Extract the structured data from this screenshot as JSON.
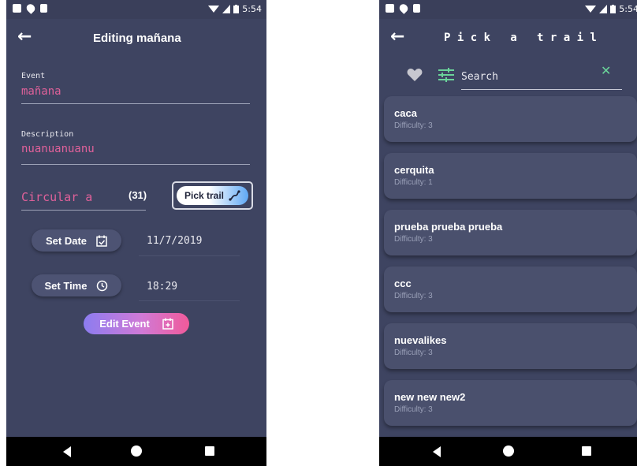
{
  "colors": {
    "background": "#3e4461",
    "accent_pink": "#e0619a",
    "card": "#4a506d",
    "green": "#6ad49a"
  },
  "status_bar": {
    "time": "5:54"
  },
  "edit_screen": {
    "title": "Editing mañana",
    "event_label": "Event",
    "event_value": "mañana",
    "description_label": "Description",
    "description_value": "nuanuanuanu",
    "trail_value": "Circular a",
    "trail_count": "(31)",
    "pick_trail_label": "Pick trail",
    "set_date_label": "Set Date",
    "date_value": "11/7/2019",
    "set_time_label": "Set Time",
    "time_value": "18:29",
    "edit_event_label": "Edit Event"
  },
  "pick_screen": {
    "title": "P i c k   a   t r a i l",
    "search_placeholder": "Search",
    "trails": [
      {
        "name": "caca",
        "difficulty": "Difficulty: 3"
      },
      {
        "name": "cerquita",
        "difficulty": "Difficulty: 1"
      },
      {
        "name": "prueba prueba prueba",
        "difficulty": "Difficulty: 3"
      },
      {
        "name": "ccc",
        "difficulty": "Difficulty: 3"
      },
      {
        "name": "nuevalikes",
        "difficulty": "Difficulty: 3"
      },
      {
        "name": "new new new2",
        "difficulty": "Difficulty: 3"
      }
    ]
  },
  "icons": [
    "gmail-icon",
    "location-pin-icon",
    "sd-card-icon",
    "wifi-icon",
    "signal-icon",
    "battery-icon",
    "back-arrow-icon",
    "hike-icon",
    "calendar-check-icon",
    "clock-icon",
    "calendar-plus-icon",
    "heart-icon",
    "filter-icon",
    "close-icon",
    "nav-back-icon",
    "nav-home-icon",
    "nav-recent-icon"
  ]
}
